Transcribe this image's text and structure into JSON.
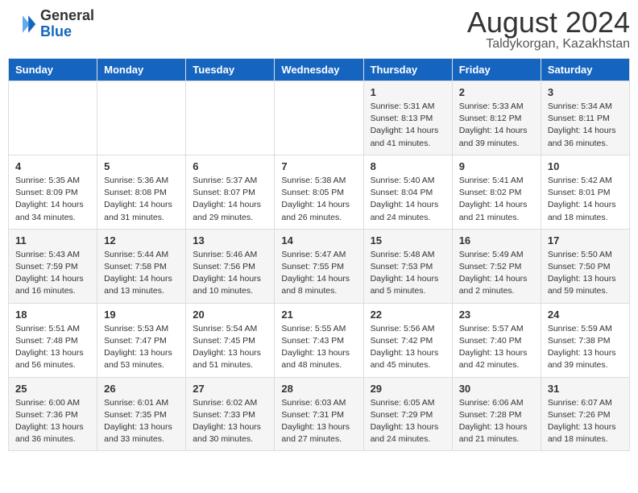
{
  "header": {
    "logo_line1": "General",
    "logo_line2": "Blue",
    "month_year": "August 2024",
    "location": "Taldykorgan, Kazakhstan"
  },
  "weekdays": [
    "Sunday",
    "Monday",
    "Tuesday",
    "Wednesday",
    "Thursday",
    "Friday",
    "Saturday"
  ],
  "weeks": [
    [
      {
        "day": "",
        "info": ""
      },
      {
        "day": "",
        "info": ""
      },
      {
        "day": "",
        "info": ""
      },
      {
        "day": "",
        "info": ""
      },
      {
        "day": "1",
        "info": "Sunrise: 5:31 AM\nSunset: 8:13 PM\nDaylight: 14 hours\nand 41 minutes."
      },
      {
        "day": "2",
        "info": "Sunrise: 5:33 AM\nSunset: 8:12 PM\nDaylight: 14 hours\nand 39 minutes."
      },
      {
        "day": "3",
        "info": "Sunrise: 5:34 AM\nSunset: 8:11 PM\nDaylight: 14 hours\nand 36 minutes."
      }
    ],
    [
      {
        "day": "4",
        "info": "Sunrise: 5:35 AM\nSunset: 8:09 PM\nDaylight: 14 hours\nand 34 minutes."
      },
      {
        "day": "5",
        "info": "Sunrise: 5:36 AM\nSunset: 8:08 PM\nDaylight: 14 hours\nand 31 minutes."
      },
      {
        "day": "6",
        "info": "Sunrise: 5:37 AM\nSunset: 8:07 PM\nDaylight: 14 hours\nand 29 minutes."
      },
      {
        "day": "7",
        "info": "Sunrise: 5:38 AM\nSunset: 8:05 PM\nDaylight: 14 hours\nand 26 minutes."
      },
      {
        "day": "8",
        "info": "Sunrise: 5:40 AM\nSunset: 8:04 PM\nDaylight: 14 hours\nand 24 minutes."
      },
      {
        "day": "9",
        "info": "Sunrise: 5:41 AM\nSunset: 8:02 PM\nDaylight: 14 hours\nand 21 minutes."
      },
      {
        "day": "10",
        "info": "Sunrise: 5:42 AM\nSunset: 8:01 PM\nDaylight: 14 hours\nand 18 minutes."
      }
    ],
    [
      {
        "day": "11",
        "info": "Sunrise: 5:43 AM\nSunset: 7:59 PM\nDaylight: 14 hours\nand 16 minutes."
      },
      {
        "day": "12",
        "info": "Sunrise: 5:44 AM\nSunset: 7:58 PM\nDaylight: 14 hours\nand 13 minutes."
      },
      {
        "day": "13",
        "info": "Sunrise: 5:46 AM\nSunset: 7:56 PM\nDaylight: 14 hours\nand 10 minutes."
      },
      {
        "day": "14",
        "info": "Sunrise: 5:47 AM\nSunset: 7:55 PM\nDaylight: 14 hours\nand 8 minutes."
      },
      {
        "day": "15",
        "info": "Sunrise: 5:48 AM\nSunset: 7:53 PM\nDaylight: 14 hours\nand 5 minutes."
      },
      {
        "day": "16",
        "info": "Sunrise: 5:49 AM\nSunset: 7:52 PM\nDaylight: 14 hours\nand 2 minutes."
      },
      {
        "day": "17",
        "info": "Sunrise: 5:50 AM\nSunset: 7:50 PM\nDaylight: 13 hours\nand 59 minutes."
      }
    ],
    [
      {
        "day": "18",
        "info": "Sunrise: 5:51 AM\nSunset: 7:48 PM\nDaylight: 13 hours\nand 56 minutes."
      },
      {
        "day": "19",
        "info": "Sunrise: 5:53 AM\nSunset: 7:47 PM\nDaylight: 13 hours\nand 53 minutes."
      },
      {
        "day": "20",
        "info": "Sunrise: 5:54 AM\nSunset: 7:45 PM\nDaylight: 13 hours\nand 51 minutes."
      },
      {
        "day": "21",
        "info": "Sunrise: 5:55 AM\nSunset: 7:43 PM\nDaylight: 13 hours\nand 48 minutes."
      },
      {
        "day": "22",
        "info": "Sunrise: 5:56 AM\nSunset: 7:42 PM\nDaylight: 13 hours\nand 45 minutes."
      },
      {
        "day": "23",
        "info": "Sunrise: 5:57 AM\nSunset: 7:40 PM\nDaylight: 13 hours\nand 42 minutes."
      },
      {
        "day": "24",
        "info": "Sunrise: 5:59 AM\nSunset: 7:38 PM\nDaylight: 13 hours\nand 39 minutes."
      }
    ],
    [
      {
        "day": "25",
        "info": "Sunrise: 6:00 AM\nSunset: 7:36 PM\nDaylight: 13 hours\nand 36 minutes."
      },
      {
        "day": "26",
        "info": "Sunrise: 6:01 AM\nSunset: 7:35 PM\nDaylight: 13 hours\nand 33 minutes."
      },
      {
        "day": "27",
        "info": "Sunrise: 6:02 AM\nSunset: 7:33 PM\nDaylight: 13 hours\nand 30 minutes."
      },
      {
        "day": "28",
        "info": "Sunrise: 6:03 AM\nSunset: 7:31 PM\nDaylight: 13 hours\nand 27 minutes."
      },
      {
        "day": "29",
        "info": "Sunrise: 6:05 AM\nSunset: 7:29 PM\nDaylight: 13 hours\nand 24 minutes."
      },
      {
        "day": "30",
        "info": "Sunrise: 6:06 AM\nSunset: 7:28 PM\nDaylight: 13 hours\nand 21 minutes."
      },
      {
        "day": "31",
        "info": "Sunrise: 6:07 AM\nSunset: 7:26 PM\nDaylight: 13 hours\nand 18 minutes."
      }
    ]
  ]
}
